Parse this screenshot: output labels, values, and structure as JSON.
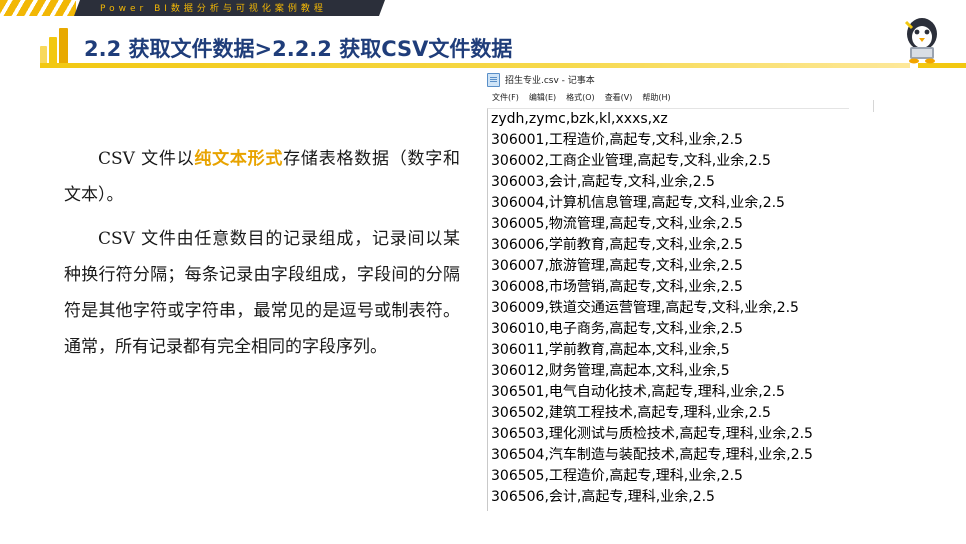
{
  "banner": {
    "tagline": "Power BI数据分析与可视化案例教程"
  },
  "header": {
    "title": "2.2 获取文件数据>2.2.2 获取CSV文件数据"
  },
  "paragraphs": {
    "p1_pre": "CSV 文件以",
    "p1_highlight": "纯文本形式",
    "p1_post": "存储表格数据（数字和文本）。",
    "p2": "CSV 文件由任意数目的记录组成，记录间以某种换行符分隔；每条记录由字段组成，字段间的分隔符是其他字符或字符串，最常见的是逗号或制表符。通常，所有记录都有完全相同的字段序列。"
  },
  "notepad": {
    "title": "招生专业.csv - 记事本",
    "menu": [
      "文件(F)",
      "编辑(E)",
      "格式(O)",
      "查看(V)",
      "帮助(H)"
    ],
    "lines": [
      "zydh,zymc,bzk,kl,xxxs,xz",
      "306001,工程造价,高起专,文科,业余,2.5",
      "306002,工商企业管理,高起专,文科,业余,2.5",
      "306003,会计,高起专,文科,业余,2.5",
      "306004,计算机信息管理,高起专,文科,业余,2.5",
      "306005,物流管理,高起专,文科,业余,2.5",
      "306006,学前教育,高起专,文科,业余,2.5",
      "306007,旅游管理,高起专,文科,业余,2.5",
      "306008,市场营销,高起专,文科,业余,2.5",
      "306009,铁道交通运营管理,高起专,文科,业余,2.5",
      "306010,电子商务,高起专,文科,业余,2.5",
      "306011,学前教育,高起本,文科,业余,5",
      "306012,财务管理,高起本,文科,业余,5",
      "306501,电气自动化技术,高起专,理科,业余,2.5",
      "306502,建筑工程技术,高起专,理科,业余,2.5",
      "306503,理化测试与质检技术,高起专,理科,业余,2.5",
      "306504,汽车制造与装配技术,高起专,理科,业余,2.5",
      "306505,工程造价,高起专,理科,业余,2.5",
      "306506,会计,高起专,理科,业余,2.5"
    ]
  },
  "colors": {
    "accent_yellow": "#f2c811",
    "title_blue": "#1f3d7a",
    "highlight_orange": "#e8a300",
    "banner_dark": "#2b2f3a"
  },
  "icons": {
    "logo": "power-bi-logo-icon",
    "mascot": "penguin-mascot-icon",
    "notepad": "notepad-icon"
  }
}
